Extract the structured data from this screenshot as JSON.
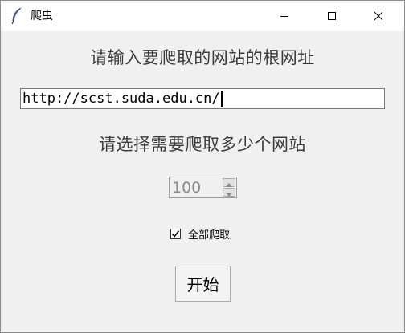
{
  "window": {
    "title": "爬虫",
    "app_icon": "feather-icon",
    "controls": {
      "minimize_icon": "minimize-icon",
      "maximize_icon": "maximize-icon",
      "close_icon": "close-icon"
    }
  },
  "form": {
    "url_prompt": "请输入要爬取的网站的根网址",
    "url_value": "http://scst.suda.edu.cn/",
    "count_prompt": "请选择需要爬取多少个网站",
    "count_value": "100",
    "crawl_all_label": "全部爬取",
    "crawl_all_checked": true,
    "start_label": "开始"
  },
  "colors": {
    "window_bg": "#f0f0f0",
    "titlebar_bg": "#ffffff",
    "disabled_text": "#8a8a8a"
  }
}
